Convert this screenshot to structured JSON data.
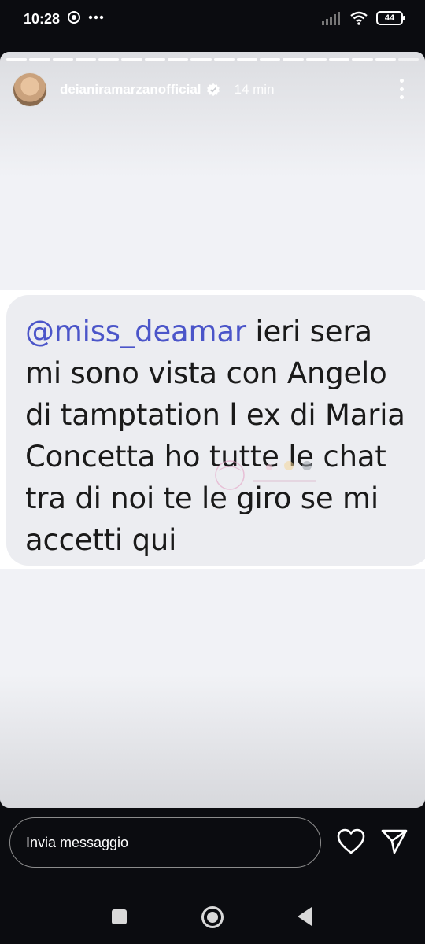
{
  "status_bar": {
    "time": "10:28",
    "battery": "44",
    "icons_left": [
      "chrome-icon",
      "more-dots-icon"
    ],
    "icons_right": [
      "signal-icon",
      "wifi-icon",
      "battery-icon"
    ]
  },
  "story": {
    "progress": {
      "segments": 18,
      "current": 17
    },
    "username": "deianiramarzanofficial",
    "verified": true,
    "time_ago": "14 min",
    "message": {
      "mention": "@miss_deamar",
      "text": " ieri sera mi sono vista con Angelo di tamptation l ex di Maria Concetta ho tutte le chat tra di noi te le giro se mi accetti qui"
    }
  },
  "reply_bar": {
    "placeholder": "Invia messaggio",
    "icons": [
      "heart-icon",
      "send-icon"
    ]
  },
  "colors": {
    "mention": "#4b55c9",
    "bubble": "#ecedf1",
    "story_bg": "#f1f2f6"
  }
}
